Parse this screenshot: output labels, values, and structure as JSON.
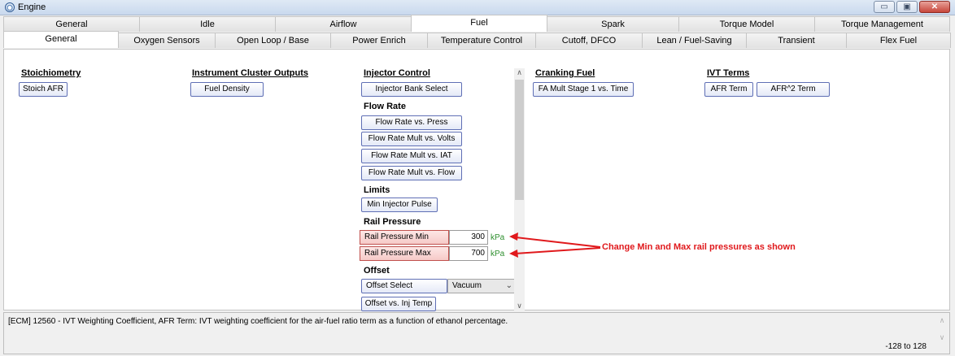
{
  "window": {
    "title": "Engine",
    "buttons": {
      "minimize": "▭",
      "maximize": "▣",
      "close": "✕"
    }
  },
  "tabs_main": [
    "General",
    "Idle",
    "Airflow",
    "Fuel",
    "Spark",
    "Torque Model",
    "Torque Management"
  ],
  "tabs_main_active": "Fuel",
  "tabs_sub": [
    "General",
    "Oxygen Sensors",
    "Open Loop / Base",
    "Power Enrich",
    "Temperature Control",
    "Cutoff, DFCO",
    "Lean / Fuel-Saving",
    "Transient",
    "Flex Fuel"
  ],
  "tabs_sub_active": "General",
  "sections": {
    "stoichiometry": {
      "heading": "Stoichiometry",
      "button": "Stoich AFR"
    },
    "instrument": {
      "heading": "Instrument Cluster Outputs",
      "button": "Fuel Density"
    },
    "injector": {
      "heading": "Injector Control",
      "button": "Injector Bank Select"
    },
    "flow_rate": {
      "heading": "Flow Rate",
      "buttons": [
        "Flow Rate vs. Press",
        "Flow Rate Mult vs. Volts",
        "Flow Rate Mult vs. IAT",
        "Flow Rate Mult vs. Flow"
      ]
    },
    "limits": {
      "heading": "Limits",
      "button": "Min Injector Pulse"
    },
    "rail_pressure": {
      "heading": "Rail Pressure",
      "rows": [
        {
          "label": "Rail Pressure Min",
          "value": "300",
          "unit": "kPa"
        },
        {
          "label": "Rail Pressure Max",
          "value": "700",
          "unit": "kPa"
        }
      ]
    },
    "offset": {
      "heading": "Offset",
      "select_label": "Offset Select",
      "select_value": "Vacuum",
      "button": "Offset vs. Inj Temp"
    },
    "cranking": {
      "heading": "Cranking Fuel",
      "button": "FA Mult Stage 1 vs. Time"
    },
    "ivt": {
      "heading": "IVT Terms",
      "buttons": [
        "AFR Term",
        "AFR^2 Term"
      ]
    }
  },
  "annotation": "Change Min and Max rail pressures as shown",
  "status": {
    "text": "[ECM] 12560 - IVT Weighting Coefficient, AFR Term: IVT weighting coefficient for the air-fuel ratio term as a function of ethanol percentage.",
    "range": "-128 to 128"
  },
  "colors": {
    "annotation": "#e0191c",
    "unit": "#2f8f2f",
    "rail_field": "#f6c9c7",
    "button_border": "#5f6fb5"
  }
}
